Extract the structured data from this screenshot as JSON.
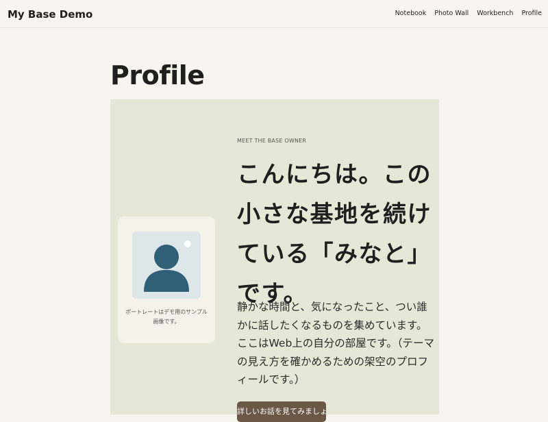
{
  "site": {
    "title": "My Base Demo"
  },
  "nav": {
    "items": [
      "Notebook",
      "Photo Wall",
      "Workbench",
      "Profile"
    ]
  },
  "page": {
    "title": "Profile"
  },
  "profile": {
    "eyebrow": "MEET THE BASE OWNER",
    "headline": "こんにちは。この小さな基地を続けている「みなと」です。",
    "intro": "静かな時間と、気になったこと、つい誰かに話したくなるものを集めています。ここはWeb上の自分の部屋です。（テーマの見え方を確かめるための架空のプロフィールです。）",
    "portrait_caption": "ポートレートはデモ用のサンプル画像です。",
    "portrait_icon": "person-icon",
    "cta_label": "詳しいお話を見てみましょう"
  },
  "colors": {
    "background": "#f7f5ef",
    "hero_background": "#e6e8d7",
    "portrait_card": "#f5f2e9",
    "portrait_frame": "#dde6e8",
    "avatar": "#2f6077",
    "button": "#6a5745"
  }
}
